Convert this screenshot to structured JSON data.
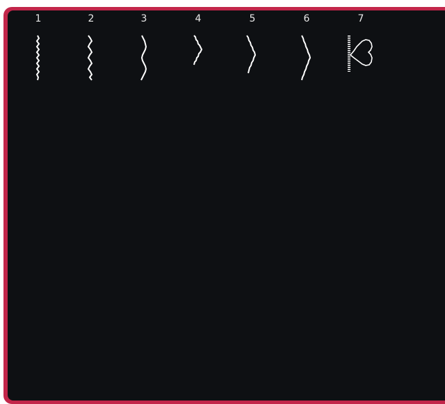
{
  "colors": {
    "frame": "#c2264a",
    "screen_background": "#0e1013",
    "stitch_line": "#ffffff",
    "number_text": "#e8e8e8"
  },
  "stitches": [
    {
      "number": "1",
      "icon": "straight-stitch-icon"
    },
    {
      "number": "2",
      "icon": "triple-straight-stitch-icon"
    },
    {
      "number": "3",
      "icon": "curved-straight-stitch-icon"
    },
    {
      "number": "4",
      "icon": "narrow-zigzag-stitch-icon"
    },
    {
      "number": "5",
      "icon": "medium-zigzag-stitch-icon"
    },
    {
      "number": "6",
      "icon": "wide-zigzag-stitch-icon"
    },
    {
      "number": "7",
      "icon": "heart-motif-stitch-icon"
    }
  ]
}
